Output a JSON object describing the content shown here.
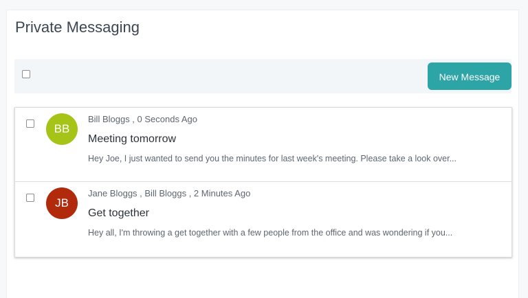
{
  "page": {
    "title": "Private Messaging"
  },
  "toolbar": {
    "new_message_label": "New Message",
    "accent_color": "#2da5a7"
  },
  "messages": [
    {
      "initials": "BB",
      "avatar_color": "#a6c417",
      "meta": "Bill Bloggs , 0 Seconds Ago",
      "subject": "Meeting tomorrow",
      "preview": "Hey Joe, I just wanted to send you the minutes for last week's meeting. Please take a look over..."
    },
    {
      "initials": "JB",
      "avatar_color": "#b12a0c",
      "meta": "Jane Bloggs , Bill Bloggs , 2 Minutes Ago",
      "subject": "Get together",
      "preview": "Hey all, I'm throwing a get together with a few people from the office and was wondering if you..."
    }
  ]
}
